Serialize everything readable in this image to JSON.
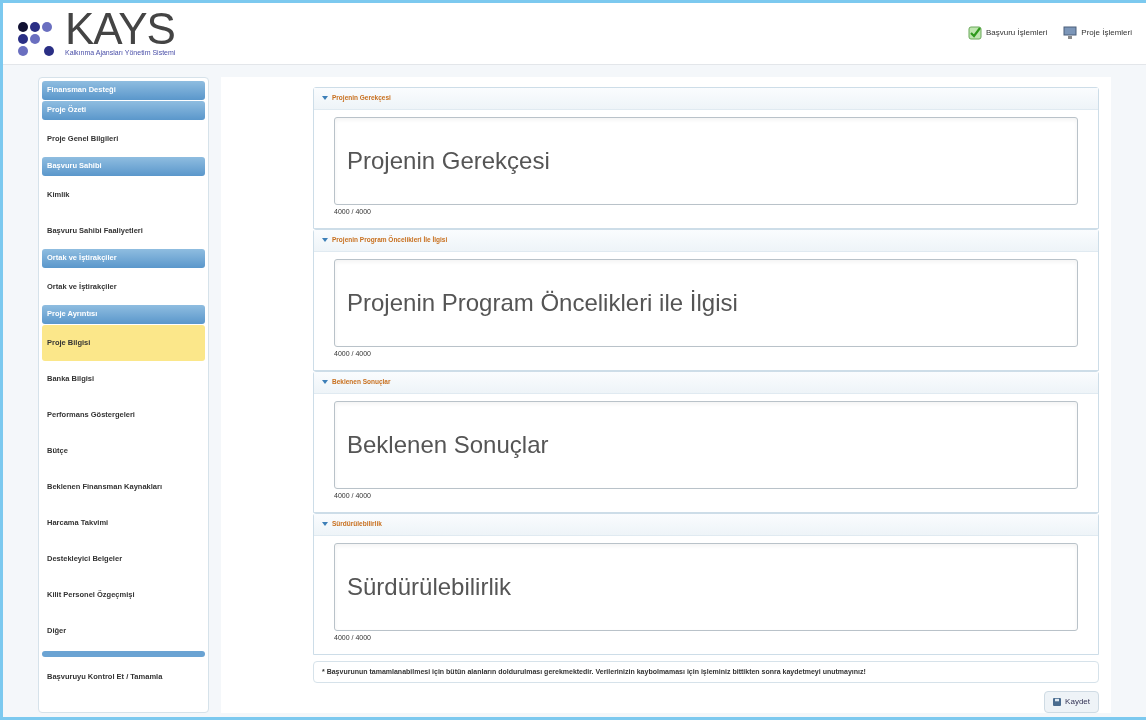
{
  "header": {
    "logo_text": "KAYS",
    "logo_subtitle": "Kalkınma Ajansları Yönetim Sistemi",
    "links": [
      {
        "kind": "check",
        "label": "Başvuru İşlemleri"
      },
      {
        "kind": "monitor",
        "label": "Proje İşlemleri"
      }
    ]
  },
  "sidebar": {
    "items": [
      {
        "kind": "header",
        "label": "Finansman Desteği"
      },
      {
        "kind": "header",
        "label": "Proje Özeti"
      },
      {
        "kind": "item",
        "label": "Proje Genel Bilgileri",
        "selected": false
      },
      {
        "kind": "header",
        "label": "Başvuru Sahibi"
      },
      {
        "kind": "item",
        "label": "Kimlik",
        "selected": false
      },
      {
        "kind": "item",
        "label": "Başvuru Sahibi Faaliyetleri",
        "selected": false
      },
      {
        "kind": "header",
        "label": "Ortak ve İştirakçiler"
      },
      {
        "kind": "item",
        "label": "Ortak ve İştirakçiler",
        "selected": false
      },
      {
        "kind": "header",
        "label": "Proje Ayrıntısı"
      },
      {
        "kind": "item",
        "label": "Proje Bilgisi",
        "selected": true
      },
      {
        "kind": "item",
        "label": "Banka Bilgisi",
        "selected": false
      },
      {
        "kind": "item",
        "label": "Performans Göstergeleri",
        "selected": false
      },
      {
        "kind": "item",
        "label": "Bütçe",
        "selected": false
      },
      {
        "kind": "item",
        "label": "Beklenen Finansman Kaynakları",
        "selected": false
      },
      {
        "kind": "item",
        "label": "Harcama Takvimi",
        "selected": false
      },
      {
        "kind": "item",
        "label": "Destekleyici Belgeler",
        "selected": false
      },
      {
        "kind": "item",
        "label": "Kilit Personel Özgeçmişi",
        "selected": false
      },
      {
        "kind": "item",
        "label": "Diğer",
        "selected": false
      },
      {
        "kind": "bar"
      },
      {
        "kind": "item",
        "label": "Başvuruyu Kontrol Et / Tamamla",
        "selected": false
      }
    ]
  },
  "sections": [
    {
      "title": "Projenin Gerekçesi",
      "value": "Projenin Gerekçesi",
      "counter": "4000 / 4000"
    },
    {
      "title": "Projenin Program Öncelikleri İle İlgisi",
      "value": "Projenin Program Öncelikleri ile İlgisi",
      "counter": "4000 / 4000"
    },
    {
      "title": "Beklenen Sonuçlar",
      "value": "Beklenen Sonuçlar",
      "counter": "4000 / 4000"
    },
    {
      "title": "Sürdürülebilirlik",
      "value": "Sürdürülebilirlik",
      "counter": "4000 / 4000"
    }
  ],
  "notice": "* Başvurunun tamamlanabilmesi için bütün alanların doldurulması gerekmektedir. Verilerinizin kaybolmaması için işleminiz bittikten sonra kaydetmeyi unutmayınız!",
  "save_button": "Kaydet"
}
